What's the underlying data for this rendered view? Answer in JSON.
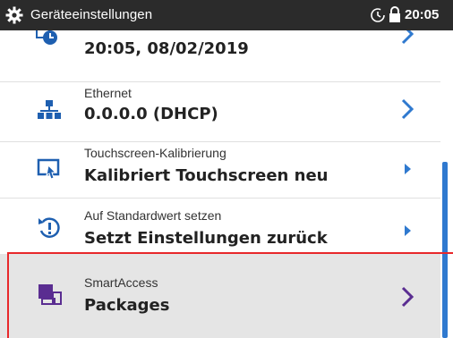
{
  "titlebar": {
    "title": "Geräteeinstellungen",
    "time": "20:05"
  },
  "rows": [
    {
      "label": "",
      "value": "20:05, 08/02/2019",
      "icon": "datetime-icon"
    },
    {
      "label": "Ethernet",
      "value": "0.0.0.0 (DHCP)",
      "icon": "network-icon"
    },
    {
      "label": "Touchscreen-Kalibrierung",
      "value": "Kalibriert Touchscreen neu",
      "icon": "touchscreen-icon"
    },
    {
      "label": "Auf Standardwert setzen",
      "value": "Setzt Einstellungen zurück",
      "icon": "reset-icon"
    },
    {
      "label": "SmartAccess",
      "value": "Packages",
      "icon": "smartaccess-icon"
    }
  ],
  "colors": {
    "accent": "#2f79cf",
    "selection_chevron": "#5a2d91",
    "highlight_outline": "#e8282b"
  }
}
